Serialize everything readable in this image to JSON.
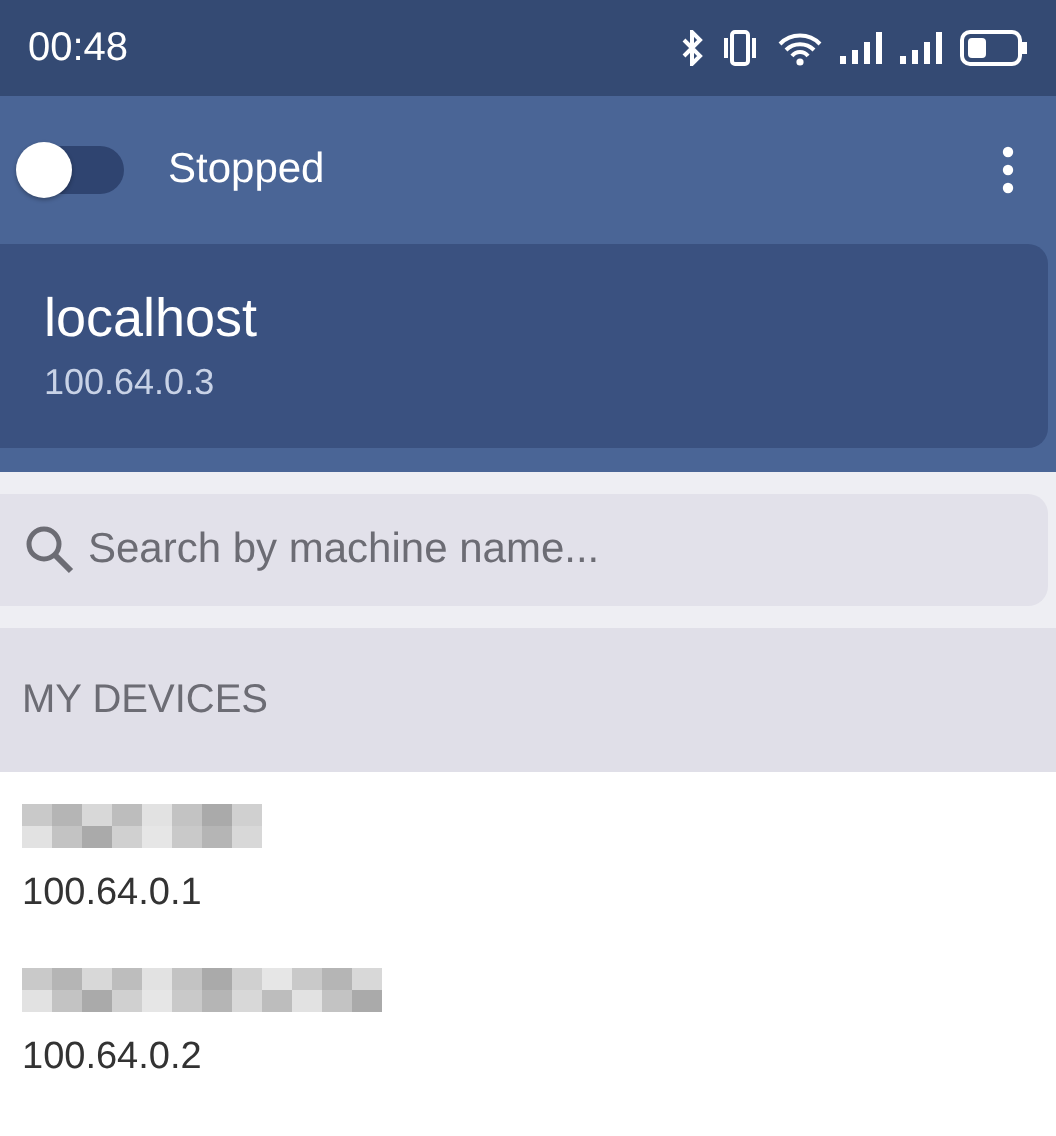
{
  "status_bar": {
    "time": "00:48"
  },
  "toolbar": {
    "switch": {
      "on": false
    },
    "status": "Stopped"
  },
  "current_machine": {
    "name": "localhost",
    "address": "100.64.0.3"
  },
  "search": {
    "placeholder": "Search by machine name..."
  },
  "section": {
    "title": "MY DEVICES"
  },
  "devices": [
    {
      "address": "100.64.0.1"
    },
    {
      "address": "100.64.0.2"
    }
  ]
}
